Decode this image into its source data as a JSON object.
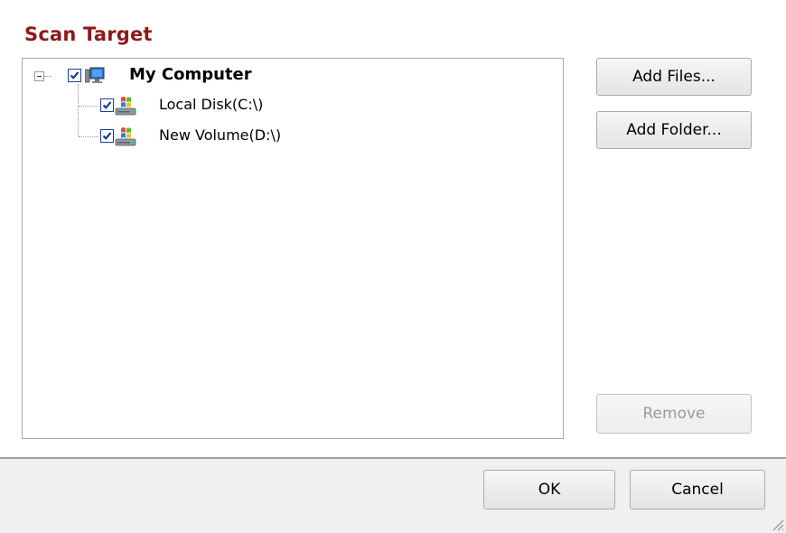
{
  "section_title": "Scan Target",
  "tree": {
    "root": {
      "label": "My Computer",
      "checked": true,
      "expanded": true,
      "icon": "computer-icon"
    },
    "children": [
      {
        "label": "Local Disk(C:\\)",
        "checked": true,
        "icon": "windows-drive-icon"
      },
      {
        "label": "New Volume(D:\\)",
        "checked": true,
        "icon": "windows-drive-icon"
      }
    ]
  },
  "buttons": {
    "add_files": "Add Files...",
    "add_folder": "Add Folder...",
    "remove": "Remove",
    "ok": "OK",
    "cancel": "Cancel"
  },
  "colors": {
    "title": "#8b1a1a",
    "checkbox_border": "#1c3f94",
    "footer_bg": "#f0f0f0"
  }
}
